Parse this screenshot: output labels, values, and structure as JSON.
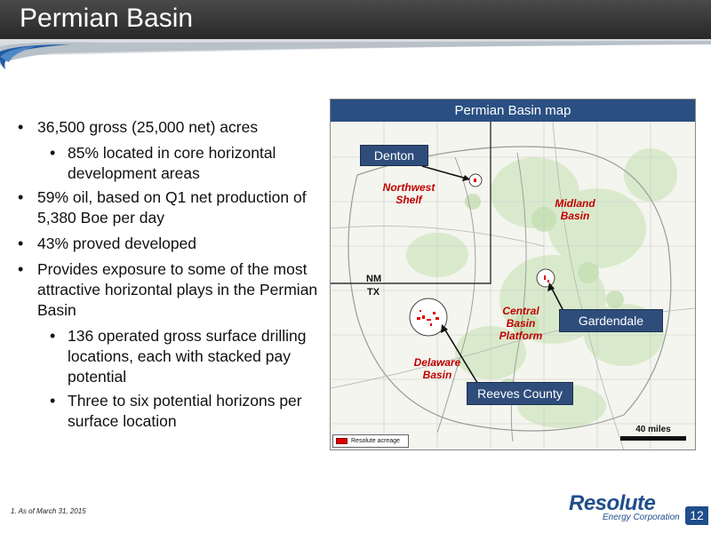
{
  "header": {
    "title": "Permian Basin"
  },
  "bullets": [
    {
      "level": 1,
      "text": "36,500 gross (25,000 net) acres"
    },
    {
      "level": 2,
      "text": "85% located in core horizontal development areas"
    },
    {
      "level": 1,
      "text": "59% oil, based on Q1 net production of 5,380 Boe per day"
    },
    {
      "level": 1,
      "text": "43% proved developed"
    },
    {
      "level": 1,
      "text": "Provides exposure to some of the most attractive horizontal plays in the Permian Basin"
    },
    {
      "level": 2,
      "text": "136 operated gross surface drilling locations, each with stacked pay potential"
    },
    {
      "level": 2,
      "text": "Three to six potential horizons per surface location"
    }
  ],
  "map": {
    "title": "Permian Basin map",
    "callouts": {
      "denton": "Denton",
      "gardendale": "Gardendale",
      "reeves": "Reeves County"
    },
    "regions": {
      "northwest": "Northwest\nShelf",
      "midland": "Midland\nBasin",
      "central": "Central\nBasin\nPlatform",
      "delaware": "Delaware\nBasin"
    },
    "states": {
      "nm": "NM",
      "tx": "TX"
    },
    "legend": "Resolute acreage",
    "scale": "40 miles",
    "colors": {
      "acreage": "#e00000",
      "callout": "#2f4d7b",
      "region_label": "#c00000"
    }
  },
  "footer": {
    "footnote": "1. As of March 31, 2015",
    "logo_main": "Resolute",
    "logo_sub": "Energy Corporation",
    "page_number": "12"
  },
  "colors": {
    "header_bg": "#333333",
    "swoosh_blue": "#1f5aa6",
    "map_title_bg": "#2a4f82"
  }
}
